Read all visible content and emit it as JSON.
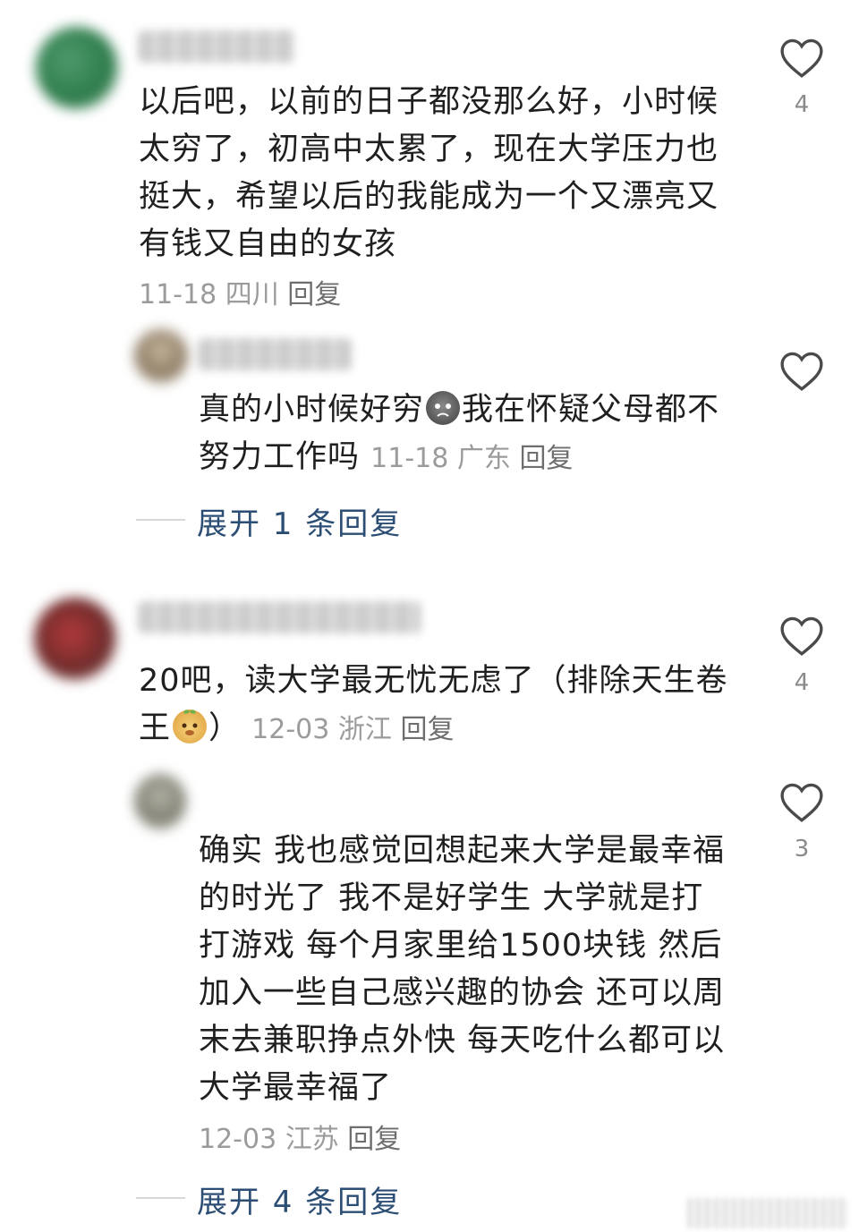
{
  "comments": [
    {
      "text": "以后吧，以前的日子都没那么好，小时候太穷了，初高中太累了，现在大学压力也挺大，希望以后的我能成为一个又漂亮又有钱又自由的女孩",
      "date": "11-18",
      "location": "四川",
      "reply_label": "回复",
      "likes": "4",
      "replies": [
        {
          "text_before": "真的小时候好穷",
          "emoji": "sad-emoji",
          "text_after": "我在怀疑父母都不努力工作吗",
          "date": "11-18",
          "location": "广东",
          "reply_label": "回复"
        }
      ],
      "expand_label": "展开 1 条回复"
    },
    {
      "text_before": "20吧，读大学最无忧无虑了（排除天生卷王",
      "emoji": "sprout-face-emoji",
      "text_after": "）",
      "date": "12-03",
      "location": "浙江",
      "reply_label": "回复",
      "likes": "4",
      "replies": [
        {
          "text": "确实 我也感觉回想起来大学是最幸福的时光了 我不是好学生 大学就是打打游戏 每个月家里给1500块钱 然后加入一些自己感兴趣的协会 还可以周末去兼职挣点外快 每天吃什么都可以 大学最幸福了",
          "date": "12-03",
          "location": "江苏",
          "reply_label": "回复",
          "likes": "3"
        }
      ],
      "expand_label": "展开 4 条回复"
    }
  ],
  "colors": {
    "link": "#2c4e74",
    "meta": "#9b9b9b",
    "text": "#1f1f1f"
  }
}
